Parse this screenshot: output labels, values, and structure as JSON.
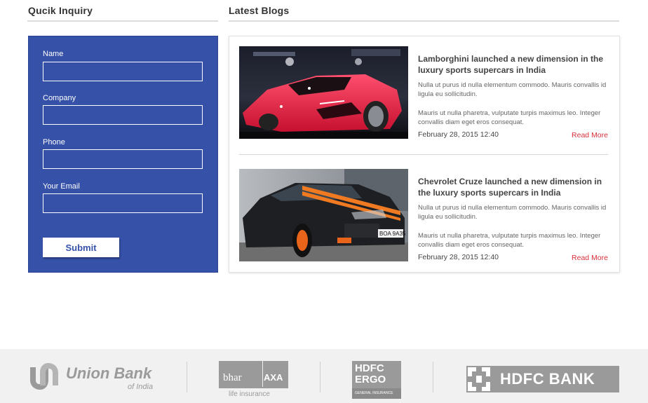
{
  "inquiry": {
    "title": "Qucik Inquiry",
    "fields": [
      {
        "label": "Name",
        "value": "",
        "placeholder": ""
      },
      {
        "label": "Company",
        "value": "",
        "placeholder": ""
      },
      {
        "label": "Phone",
        "value": "",
        "placeholder": ""
      },
      {
        "label": "Your Email",
        "value": "",
        "placeholder": ""
      }
    ],
    "submit_label": "Submit"
  },
  "blogs": {
    "title": "Latest Blogs",
    "items": [
      {
        "title": "Lamborghini launched a new dimension in the luxury sports supercars in India",
        "para1": "Nulla ut purus id nulla elementum commodo. Mauris convallis id ligula eu sollicitudin.",
        "para2": "Mauris ut nulla pharetra, vulputate turpis maximus leo. Integer convallis diam eget eros consequat.",
        "date": "February 28, 2015 12:40",
        "read_more": "Read More"
      },
      {
        "title": "Chevrolet Cruze launched a new dimension in the luxury sports supercars in India",
        "para1": "Nulla ut purus id nulla elementum commodo. Mauris convallis id ligula eu sollicitudin.",
        "para2": "Mauris ut nulla pharetra, vulputate turpis maximus leo. Integer convallis diam eget eros consequat.",
        "date": "February 28, 2015 12:40",
        "read_more": "Read More"
      }
    ]
  },
  "partners": {
    "union_bank": {
      "name": "Union Bank",
      "sub": "of India"
    },
    "bharti_axa": {
      "name_left": "bhar",
      "name_right": "AXA",
      "sub": "life insurance"
    },
    "hdfc_ergo": {
      "line1": "HDFC",
      "line2": "ERGO",
      "sub": "GENERAL INSURANCE"
    },
    "hdfc_bank": {
      "name": "HDFC BANK"
    }
  },
  "colors": {
    "form_bg": "#3651a8",
    "read_more": "#d9303a",
    "partner_gray": "#9a9a9a"
  }
}
